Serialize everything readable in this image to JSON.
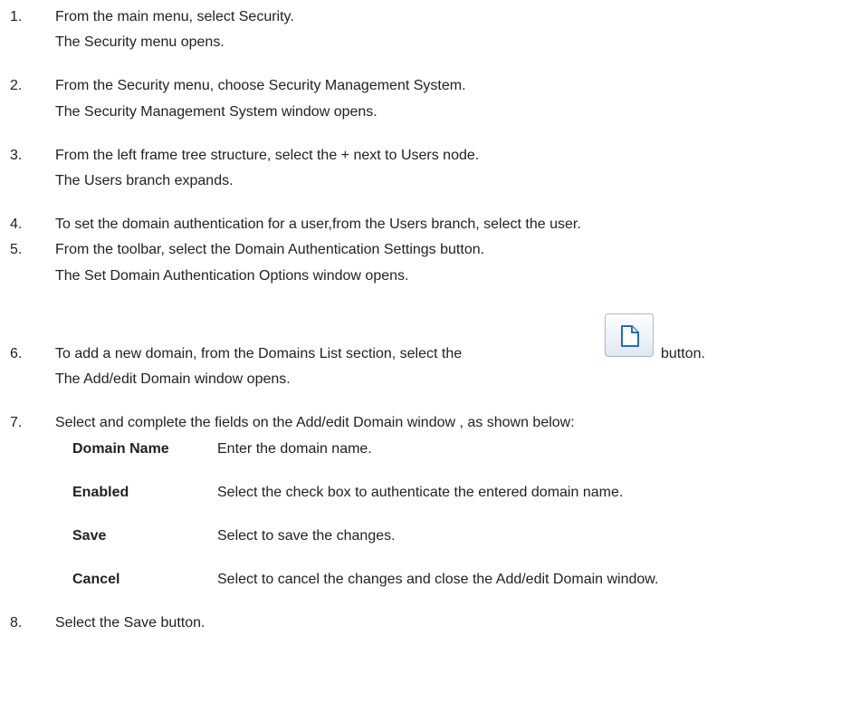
{
  "steps": [
    {
      "num": "1.",
      "lines": [
        "From the main menu, select Security.",
        "The Security menu opens."
      ]
    },
    {
      "num": "2.",
      "lines": [
        "From the Security menu, choose Security Management System.",
        "The Security Management System window opens."
      ]
    },
    {
      "num": "3.",
      "lines": [
        "From the left frame tree structure, select the + next to Users node.",
        "The Users branch expands."
      ]
    },
    {
      "num": "4.",
      "lines": [
        "To set the domain authentication for a user,from the Users branch, select the user."
      ]
    },
    {
      "num": "5.",
      "lines": [
        "From the toolbar, select the Domain Authentication Settings  button.",
        "The Set Domain Authentication Options window opens."
      ]
    },
    {
      "num": "6.",
      "lines": [
        "To add a new domain, from the Domains List section, select the",
        "button.",
        "The Add/edit Domain window opens."
      ]
    },
    {
      "num": "7.",
      "lines": [
        "Select and complete the fields on the Add/edit Domain window  , as shown below:"
      ]
    },
    {
      "num": "8.",
      "lines": [
        "Select the Save button."
      ]
    }
  ],
  "fields": [
    {
      "name": "Domain Name",
      "desc": "Enter the domain name."
    },
    {
      "name": "Enabled",
      "desc": "Select the check box to authenticate the entered domain name."
    },
    {
      "name": "Save",
      "desc": "Select to save the changes."
    },
    {
      "name": "Cancel",
      "desc": "Select to cancel the changes and close the Add/edit Domain window."
    }
  ],
  "icons": {
    "new_domain_button": "new-document-icon"
  }
}
